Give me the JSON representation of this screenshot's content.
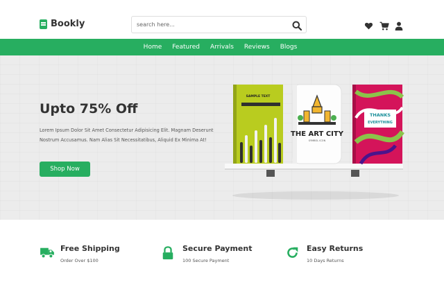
{
  "brand": {
    "name": "Bookly",
    "accent": "#27ae60"
  },
  "search": {
    "placeholder": "search here..."
  },
  "header_icons": [
    "heart-icon",
    "cart-icon",
    "user-icon"
  ],
  "nav": {
    "items": [
      "Home",
      "Featured",
      "Arrivals",
      "Reviews",
      "Blogs"
    ]
  },
  "hero": {
    "title": "Upto 75% Off",
    "description": "Lorem Ipsum Dolor Sit Amet Consectetur Adipisicing Elit. Magnam Deserunt Nostrum Accusamus. Nam Alias Sit Necessitatibus, Aliquid Ex Minima At!",
    "button": "Shop Now",
    "books": {
      "book1": "SAMPLE TEXT",
      "book2_title": "THE ART CITY",
      "book2_sub": "SYMBOL ICON",
      "book3_line1": "THANKS",
      "book3_line2": "EVERYTHING"
    }
  },
  "features": [
    {
      "icon": "truck-icon",
      "title": "Free Shipping",
      "subtitle": "Order Over $100"
    },
    {
      "icon": "lock-icon",
      "title": "Secure Payment",
      "subtitle": "100 Secure Payment"
    },
    {
      "icon": "redo-icon",
      "title": "Easy Returns",
      "subtitle": "10 Days Returns"
    }
  ]
}
